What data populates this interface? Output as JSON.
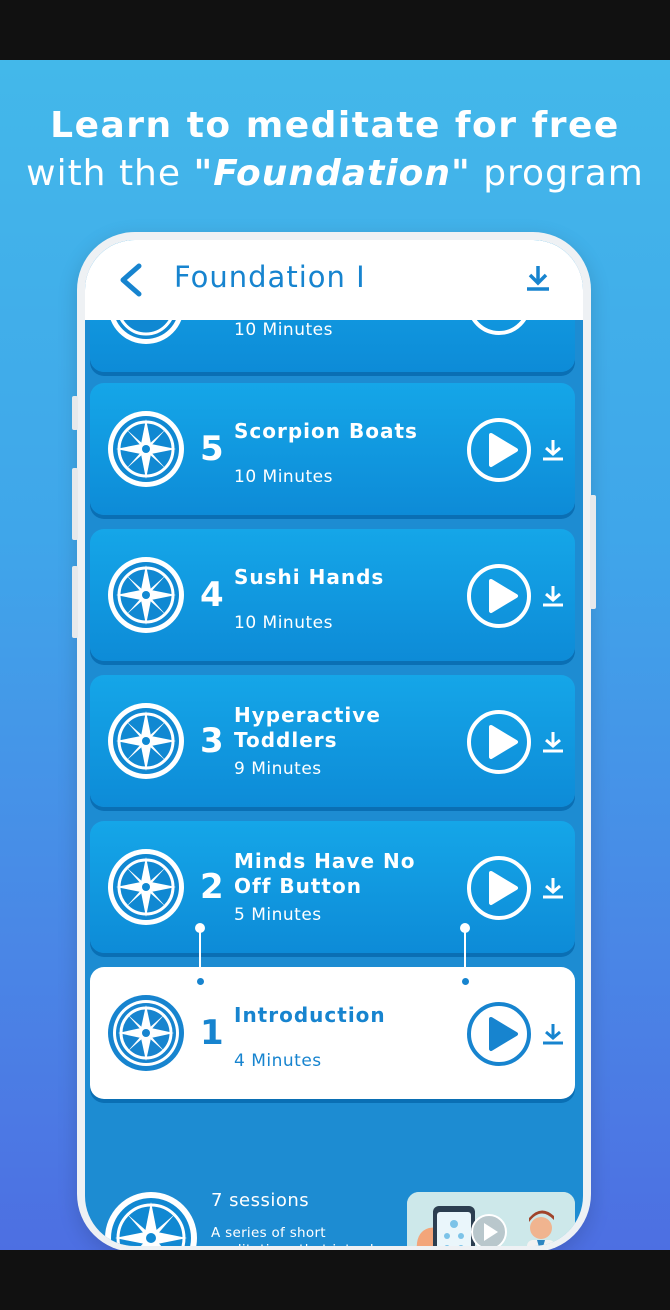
{
  "headline": {
    "line1": "Learn to meditate for free",
    "line2_prefix": "with the ",
    "line2_program": "\"Foundation\"",
    "line2_suffix": " program"
  },
  "appbar": {
    "title": "Foundation I",
    "back_icon": "chevron-left-icon",
    "download_icon": "download-icon"
  },
  "sessions": [
    {
      "number": "",
      "name": "",
      "duration": "10 Minutes"
    },
    {
      "number": "5",
      "name": "Scorpion Boats",
      "duration": "10 Minutes"
    },
    {
      "number": "4",
      "name": "Sushi Hands",
      "duration": "10 Minutes"
    },
    {
      "number": "3",
      "name": "Hyperactive Toddlers",
      "duration": "9 Minutes"
    },
    {
      "number": "2",
      "name": "Minds Have No Off Button",
      "duration": "5 Minutes"
    },
    {
      "number": "1",
      "name": "Introduction",
      "duration": "4 Minutes"
    }
  ],
  "program": {
    "sessions_count": "7 sessions",
    "description": "A series of short meditations that introduce, explain and use various mindfulness tools."
  },
  "colors": {
    "accent": "#1784cf",
    "card_top": "#15a6e8",
    "card_bottom": "#0d8bd7",
    "background_top": "#43b8ea",
    "background_bottom": "#4d6fe2"
  }
}
